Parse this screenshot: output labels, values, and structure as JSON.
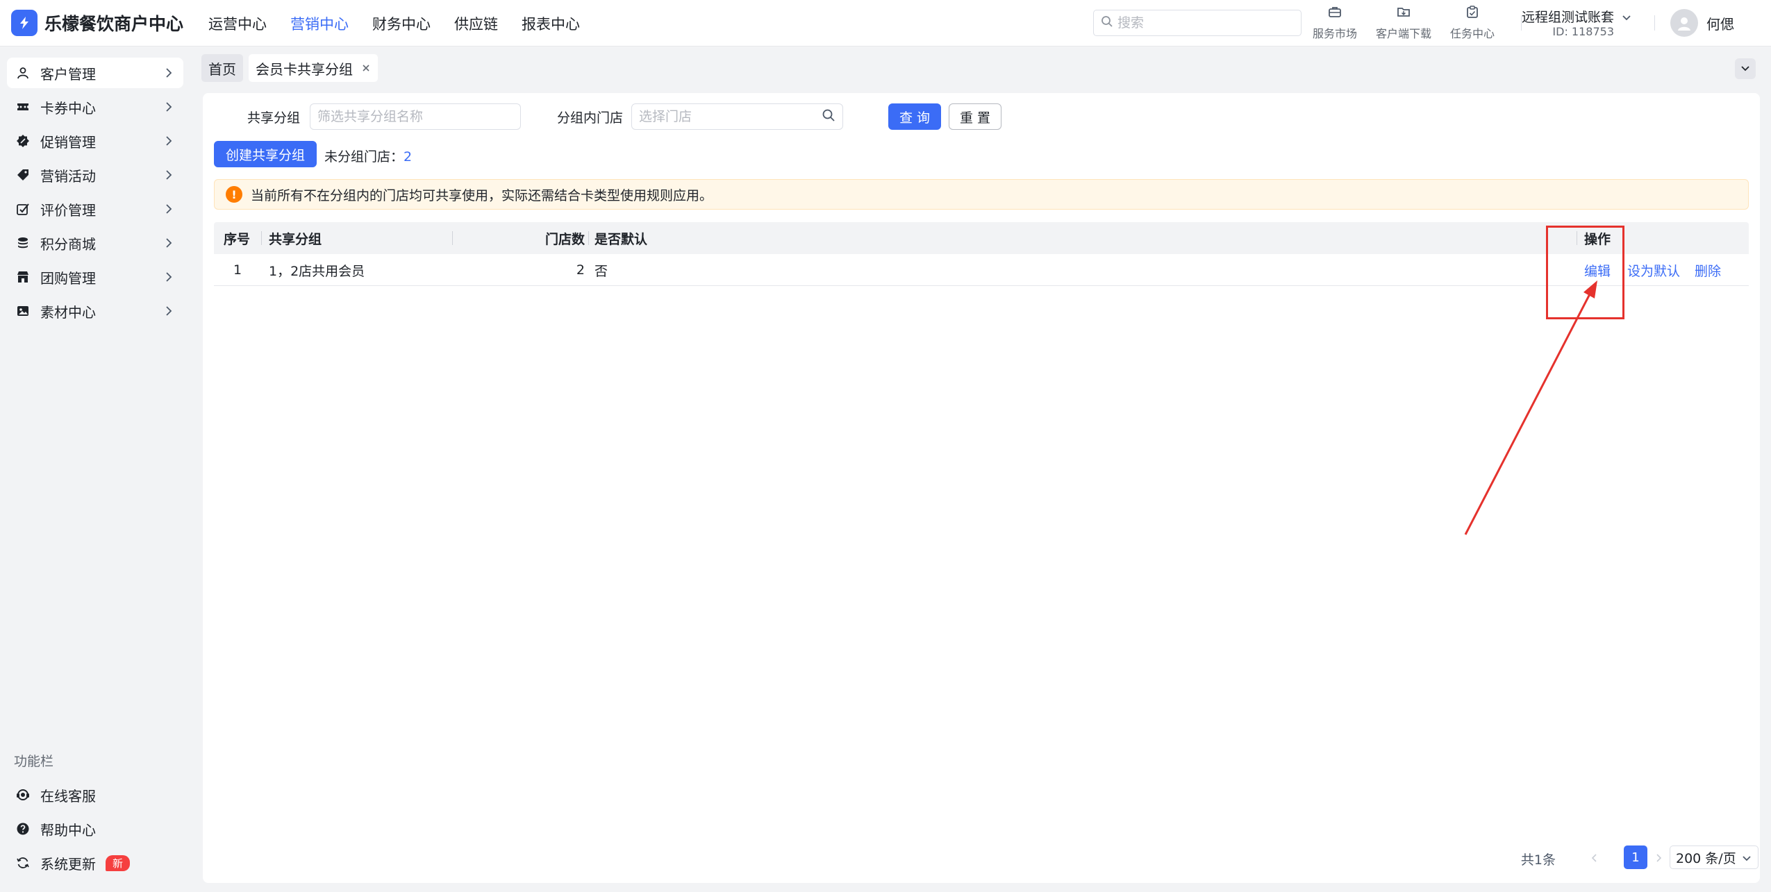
{
  "app": {
    "title": "乐檬餐饮商户中心"
  },
  "topnav": [
    {
      "label": "运营中心",
      "active": false
    },
    {
      "label": "营销中心",
      "active": true
    },
    {
      "label": "财务中心",
      "active": false
    },
    {
      "label": "供应链",
      "active": false
    },
    {
      "label": "报表中心",
      "active": false
    }
  ],
  "search": {
    "placeholder": "搜索",
    "value": ""
  },
  "tools": {
    "market": "服务市场",
    "download": "客户端下载",
    "tasks": "任务中心"
  },
  "account": {
    "name": "远程组测试账套",
    "id": "ID: 118753"
  },
  "user": {
    "name": "何偲"
  },
  "sidebar": {
    "items": [
      {
        "label": "客户管理",
        "icon": "user-icon",
        "active": true
      },
      {
        "label": "卡券中心",
        "icon": "ticket-icon",
        "active": false
      },
      {
        "label": "促销管理",
        "icon": "discount-icon",
        "active": false
      },
      {
        "label": "营销活动",
        "icon": "tag-icon",
        "active": false
      },
      {
        "label": "评价管理",
        "icon": "review-icon",
        "active": false
      },
      {
        "label": "积分商城",
        "icon": "coins-icon",
        "active": false
      },
      {
        "label": "团购管理",
        "icon": "store-icon",
        "active": false
      },
      {
        "label": "素材中心",
        "icon": "image-icon",
        "active": false
      }
    ],
    "section_label": "功能栏",
    "bottom_items": [
      {
        "label": "在线客服",
        "icon": "headset-icon"
      },
      {
        "label": "帮助中心",
        "icon": "help-icon"
      },
      {
        "label": "系统更新",
        "icon": "refresh-icon",
        "badge": "新"
      }
    ]
  },
  "tabs": {
    "home": "首页",
    "current": "会员卡共享分组"
  },
  "filters": {
    "group_label": "共享分组",
    "group_placeholder": "筛选共享分组名称",
    "store_label": "分组内门店",
    "store_placeholder": "选择门店",
    "query_button": "查 询",
    "reset_button": "重 置"
  },
  "toolbar": {
    "create_button": "创建共享分组",
    "ungrouped_label": "未分组门店：",
    "ungrouped_count": "2"
  },
  "alert": {
    "text": "当前所有不在分组内的门店均可共享使用，实际还需结合卡类型使用规则应用。"
  },
  "table": {
    "headers": {
      "index": "序号",
      "group": "共享分组",
      "stores": "门店数",
      "default": "是否默认",
      "actions": "操作"
    },
    "rows": [
      {
        "index": "1",
        "group": "1，2店共用会员",
        "stores": "2",
        "default": "否"
      }
    ],
    "actions": {
      "edit": "编辑",
      "set_default": "设为默认",
      "delete": "删除"
    }
  },
  "pager": {
    "total": "共1条",
    "current_page": "1",
    "page_size": "200 条/页"
  },
  "colors": {
    "accent": "#3b6cf6",
    "warning": "#ff7d00",
    "annotation": "#e5322d",
    "badge": "#f53f3f"
  }
}
